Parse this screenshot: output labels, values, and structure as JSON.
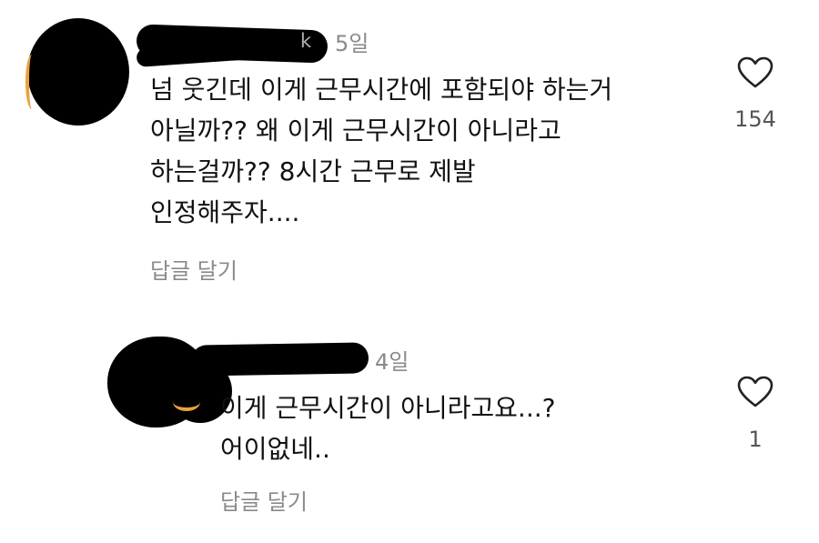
{
  "comments": [
    {
      "author_suffix": "k",
      "timestamp": "5일",
      "lines": [
        "넘 웃긴데 이게 근무시간에 포함되야 하는거",
        "아닐까?? 왜  이게 근무시간이 아니라고",
        "하는걸까?? 8시간 근무로 제발",
        "인정해주자...."
      ],
      "reply_label": "답글 달기",
      "like_icon": "heart-outline-icon",
      "like_count": "154"
    },
    {
      "author_suffix": "",
      "timestamp": "4일",
      "lines": [
        "이게 근무시간이 아니라고요...?",
        "어이없네.."
      ],
      "reply_label": "답글 달기",
      "like_icon": "heart-outline-icon",
      "like_count": "1"
    }
  ],
  "redaction_color": "#000000",
  "avatar_ring_color": "#e8a23a"
}
